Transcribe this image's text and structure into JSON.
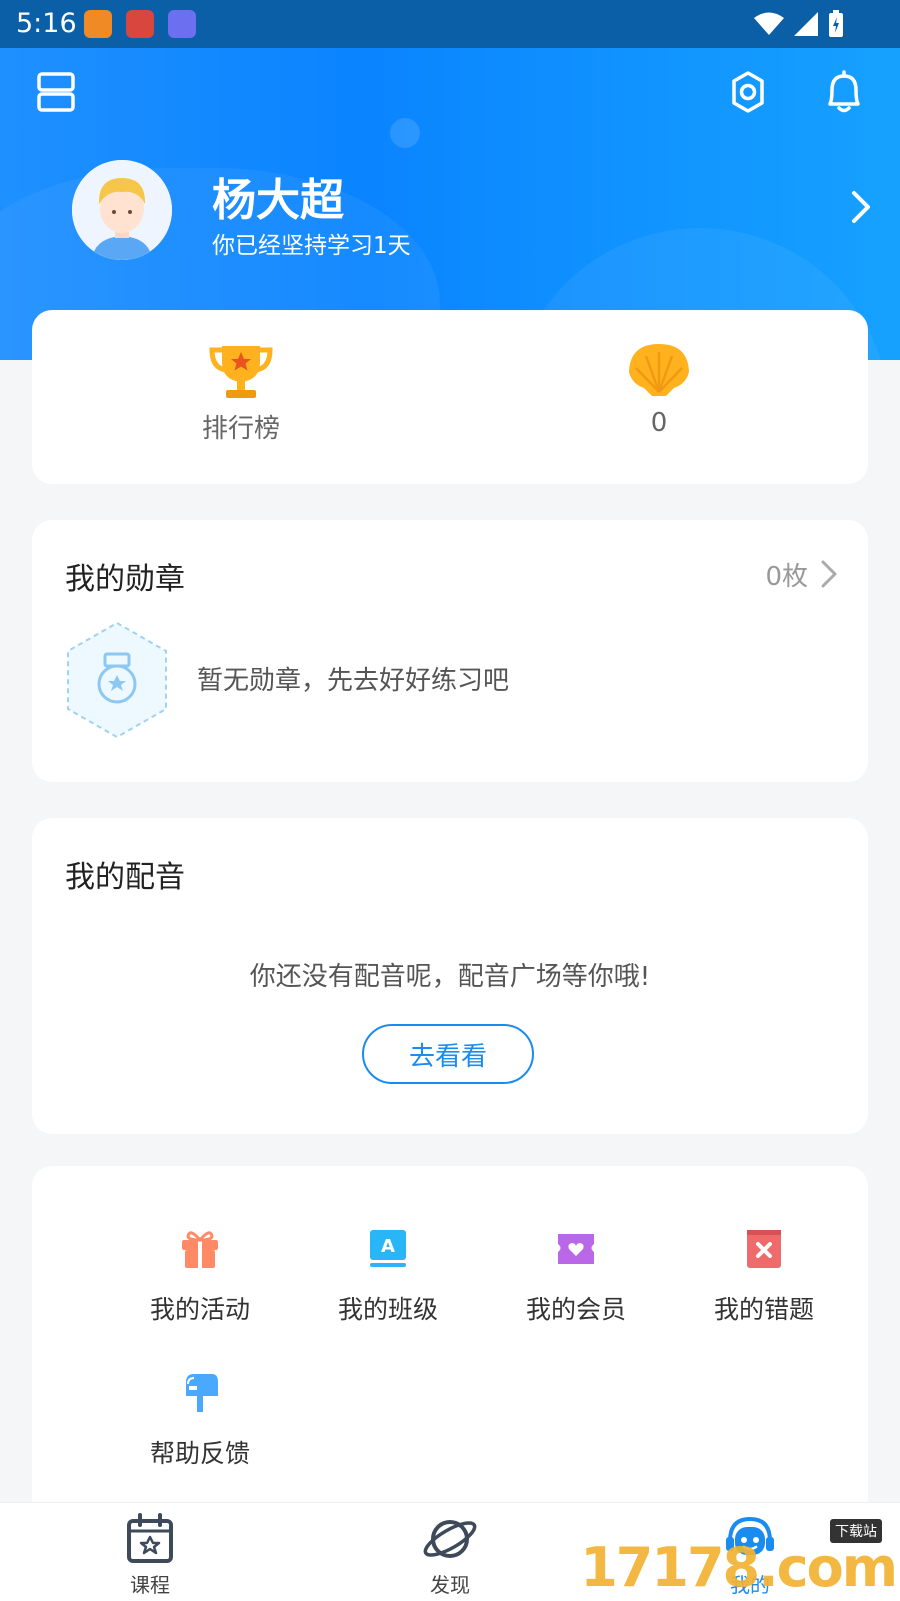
{
  "status_bar": {
    "time": "5:16"
  },
  "profile": {
    "name": "杨大超",
    "subtitle": "你已经坚持学习1天"
  },
  "stats": {
    "ranking_label": "排行榜",
    "shells_count": "0"
  },
  "medals": {
    "title": "我的勋章",
    "count": "0枚",
    "empty_text": "暂无勋章，先去好好练习吧"
  },
  "dubbing": {
    "title": "我的配音",
    "empty_text": "你还没有配音呢，配音广场等你哦!",
    "button_label": "去看看"
  },
  "grid": {
    "items": [
      {
        "label": "我的活动",
        "icon": "gift-icon",
        "color": "#ff8a65"
      },
      {
        "label": "我的班级",
        "icon": "class-icon",
        "color": "#29b6f6"
      },
      {
        "label": "我的会员",
        "icon": "member-ticket-icon",
        "color": "#ba68e8"
      },
      {
        "label": "我的错题",
        "icon": "wrong-questions-icon",
        "color": "#ef6a6a"
      },
      {
        "label": "帮助反馈",
        "icon": "feedback-mailbox-icon",
        "color": "#4aa8ff"
      }
    ]
  },
  "tabs": [
    {
      "label": "课程",
      "icon": "calendar-star-icon"
    },
    {
      "label": "发现",
      "icon": "planet-icon"
    },
    {
      "label": "我的",
      "icon": "robot-headset-icon"
    }
  ],
  "watermark": {
    "text": "17178.com",
    "sub": "下载站"
  },
  "colors": {
    "accent": "#1a8cf0",
    "header": "#0a84ff"
  }
}
